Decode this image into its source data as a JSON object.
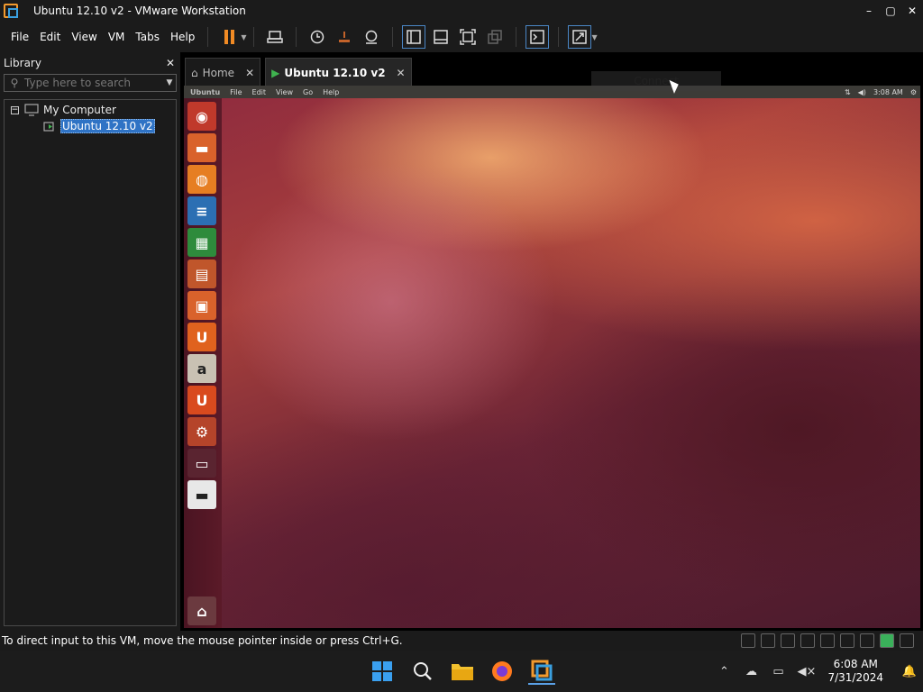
{
  "window": {
    "title": "Ubuntu 12.10 v2 - VMware Workstation",
    "controls": [
      "–",
      "▢",
      "✕"
    ]
  },
  "menu": {
    "items": [
      "File",
      "Edit",
      "View",
      "VM",
      "Tabs",
      "Help"
    ]
  },
  "toolbar": {
    "icons": [
      "pause-icon",
      "send-keys-icon",
      "snapshot-icon",
      "revert-snapshot-icon",
      "snapshot-manager-icon",
      "library-view-icon",
      "thumbnail-view-icon",
      "full-screen-icon",
      "unity-icon",
      "console-view-icon",
      "stretch-icon"
    ]
  },
  "library": {
    "title": "Library",
    "close": "✕",
    "search_placeholder": "Type here to search",
    "tree": {
      "root": "My Computer",
      "expander": "−",
      "vm": "Ubuntu 12.10 v2"
    }
  },
  "tabs": [
    {
      "label": "Home",
      "close": "✕",
      "icon": "home-icon"
    },
    {
      "label": "Ubuntu 12.10 v2",
      "close": "✕",
      "icon": "vm-icon",
      "active": true
    }
  ],
  "guest": {
    "panel": {
      "brand": "Ubuntu",
      "menus": [
        "File",
        "Edit",
        "View",
        "Go",
        "Help"
      ],
      "time": "3:08 AM"
    },
    "popup": "Connect",
    "launcher": [
      {
        "name": "dash-home",
        "glyph": "◉",
        "bg": "#c0392b"
      },
      {
        "name": "files",
        "glyph": "▬",
        "bg": "#d9622b"
      },
      {
        "name": "firefox",
        "glyph": "◍",
        "bg": "#e67e22"
      },
      {
        "name": "writer",
        "glyph": "≡",
        "bg": "#2c6fb3"
      },
      {
        "name": "calc",
        "glyph": "▦",
        "bg": "#2e8b3c"
      },
      {
        "name": "impress",
        "glyph": "▤",
        "bg": "#c0562b"
      },
      {
        "name": "software-center",
        "glyph": "▣",
        "bg": "#d9622b"
      },
      {
        "name": "ubuntu-one",
        "glyph": "U",
        "bg": "#e0621e"
      },
      {
        "name": "amazon",
        "glyph": "a",
        "bg": "#c9c1b3"
      },
      {
        "name": "ubuntu-one-music",
        "glyph": "U",
        "bg": "#d94a1e"
      },
      {
        "name": "system-settings",
        "glyph": "⚙",
        "bg": "#b5442a"
      },
      {
        "name": "workspace-switcher",
        "glyph": "▭",
        "bg": "#5a2430"
      },
      {
        "name": "floppy",
        "glyph": "▬",
        "bg": "#e8e8e8"
      },
      {
        "name": "trash",
        "glyph": "⌂",
        "bg": "#6b3a3f"
      }
    ]
  },
  "status": {
    "message": "To direct input to this VM, move the mouse pointer inside or press Ctrl+G."
  },
  "taskbar": {
    "apps": [
      "windows-start-icon",
      "search-icon",
      "file-explorer-icon",
      "firefox-icon",
      "vmware-icon"
    ],
    "clock": {
      "time": "6:08 AM",
      "date": "7/31/2024"
    }
  },
  "colors": {
    "accent": "#f08a24",
    "selection": "#2f73c5",
    "chrome": "#1b1b1b"
  }
}
